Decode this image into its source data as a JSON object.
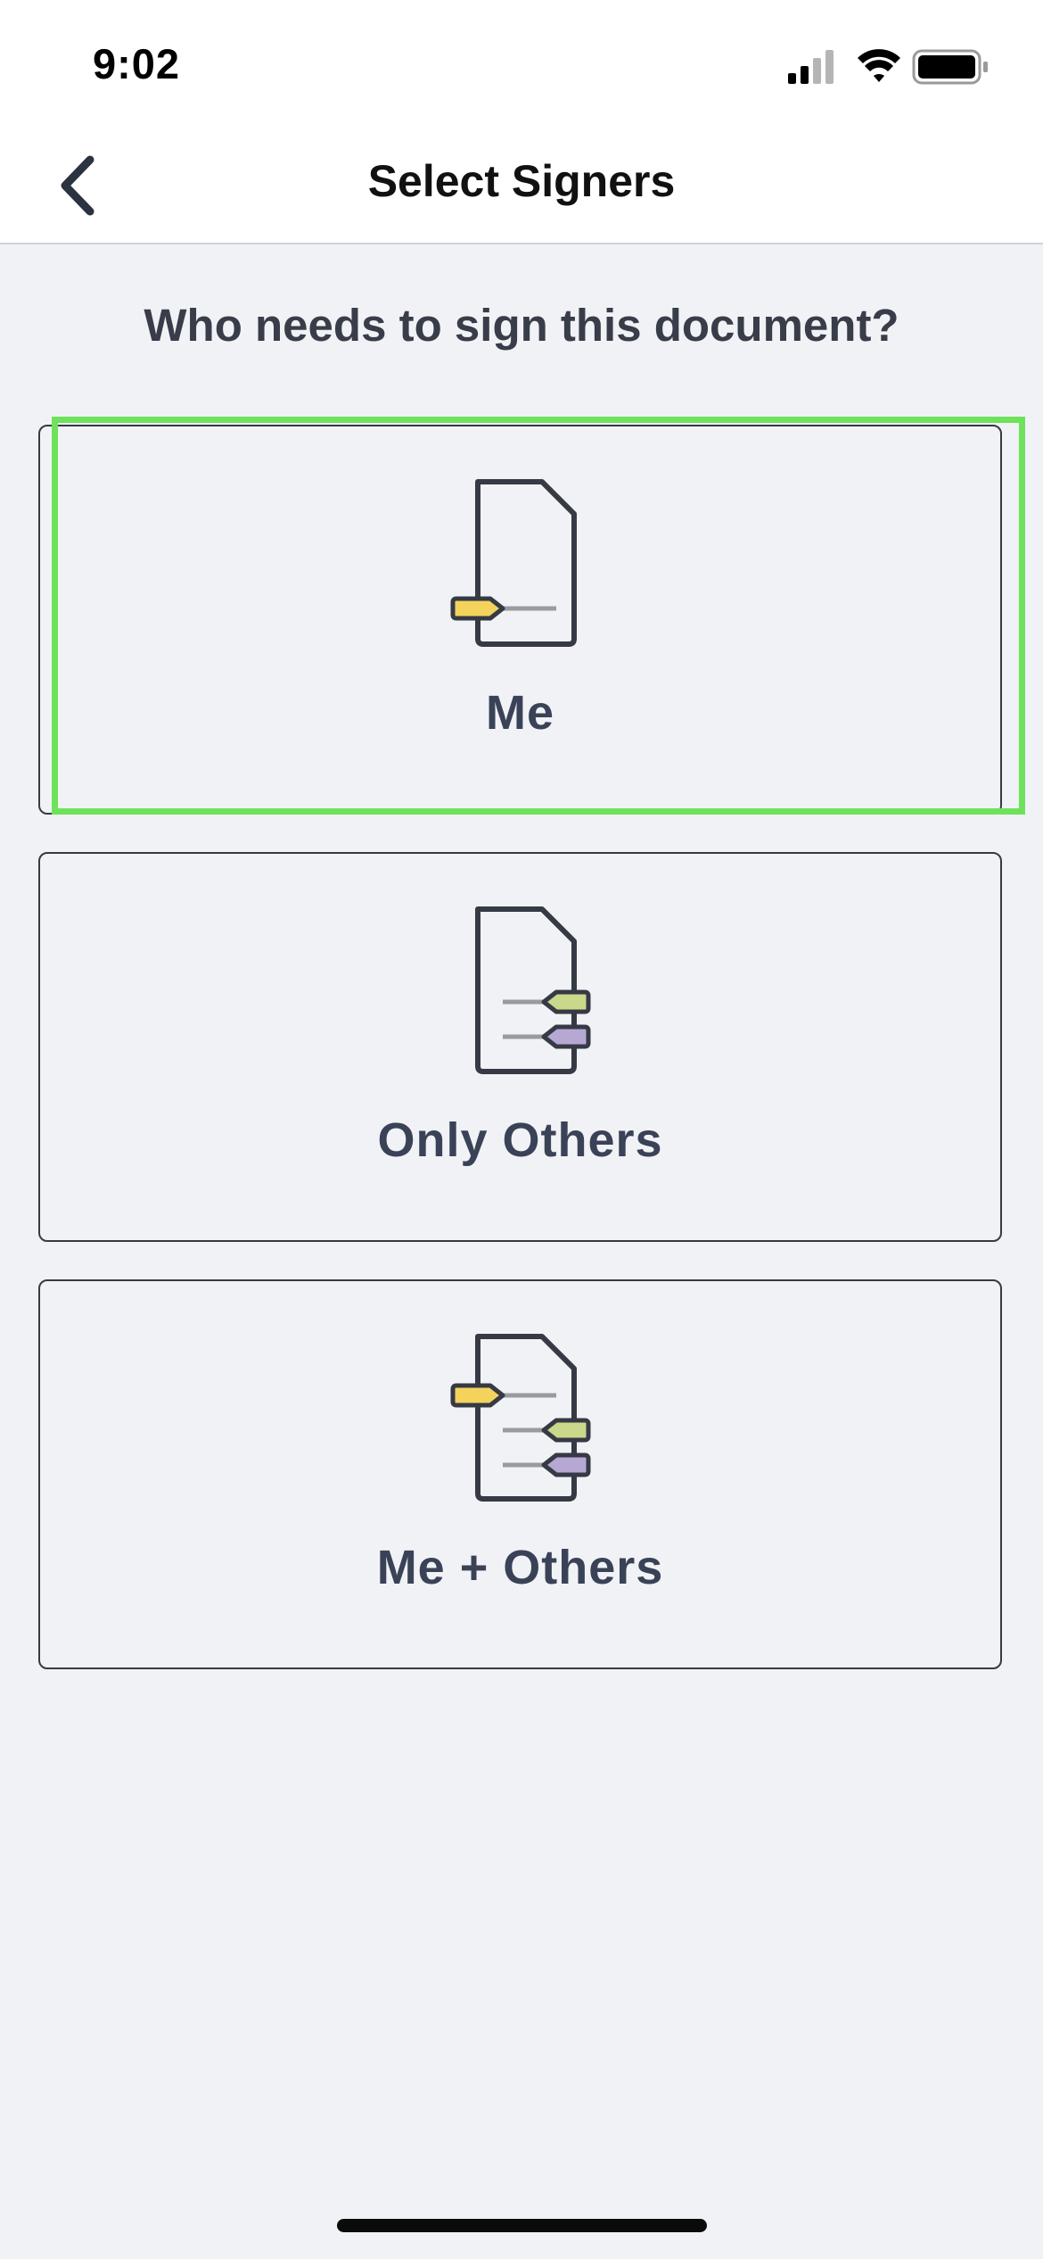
{
  "status_bar": {
    "time": "9:02"
  },
  "nav": {
    "title": "Select Signers",
    "back_icon": "chevron-left-icon"
  },
  "prompt": "Who needs to sign this document?",
  "options": [
    {
      "label": "Me",
      "icon": "document-me-icon"
    },
    {
      "label": "Only Others",
      "icon": "document-others-icon"
    },
    {
      "label": "Me + Others",
      "icon": "document-me-others-icon"
    }
  ],
  "colors": {
    "me_tag": "#f3d35c",
    "other_tag_1": "#c9d88a",
    "other_tag_2": "#b7a8d3",
    "highlight": "#6de25a",
    "card_border": "#363a45",
    "label_text": "#3a4257"
  }
}
